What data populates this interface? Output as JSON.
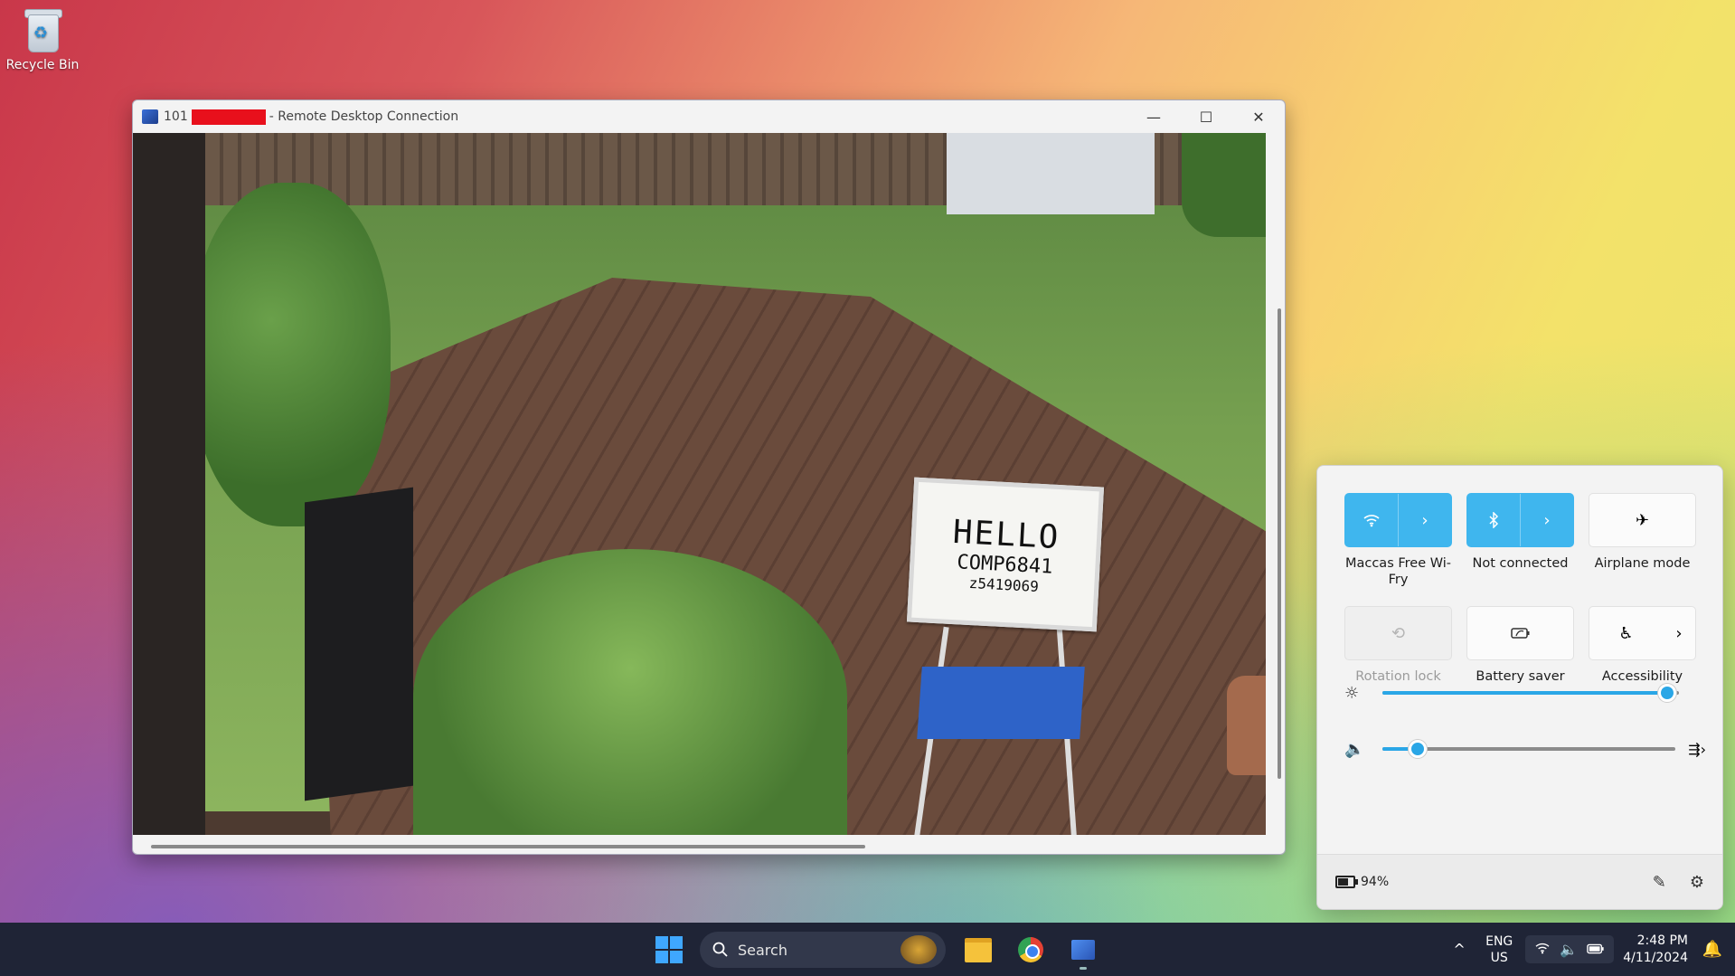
{
  "desktop": {
    "icons": [
      {
        "label": "Recycle Bin",
        "icon": "recycle-bin-icon"
      }
    ]
  },
  "rdp_window": {
    "title_prefix": "101",
    "title_suffix": "- Remote Desktop Connection",
    "controls": {
      "minimize": "—",
      "maximize": "☐",
      "close": "✕"
    },
    "remote_content": {
      "sign_lines": [
        "HELLO",
        "COMP6841",
        "z5419069"
      ]
    }
  },
  "quick_settings": {
    "tiles": [
      {
        "label": "Maccas Free Wi-Fry",
        "icon": "wifi-icon",
        "state": "on",
        "expandable": true
      },
      {
        "label": "Not connected",
        "icon": "bluetooth-icon",
        "state": "on",
        "expandable": true
      },
      {
        "label": "Airplane mode",
        "icon": "airplane-icon",
        "state": "off",
        "expandable": false
      },
      {
        "label": "Rotation lock",
        "icon": "rotation-lock-icon",
        "state": "disabled",
        "expandable": false
      },
      {
        "label": "Battery saver",
        "icon": "battery-saver-icon",
        "state": "off",
        "expandable": false
      },
      {
        "label": "Accessibility",
        "icon": "accessibility-icon",
        "state": "off",
        "expandable": true
      }
    ],
    "brightness": {
      "icon": "brightness-icon",
      "value": 0.96
    },
    "volume": {
      "icon": "speaker-icon",
      "value": 0.12
    },
    "footer": {
      "battery": "94%",
      "battery_level": 0.94,
      "edit_icon": "pencil-icon",
      "settings_icon": "gear-icon"
    },
    "accent_color": "#3fb6ee"
  },
  "taskbar": {
    "search_label": "Search",
    "apps": [
      "file-explorer-icon",
      "chrome-icon",
      "remote-desktop-icon"
    ],
    "language": {
      "line1": "ENG",
      "line2": "US"
    },
    "time": "2:48 PM",
    "date": "4/11/2024"
  }
}
